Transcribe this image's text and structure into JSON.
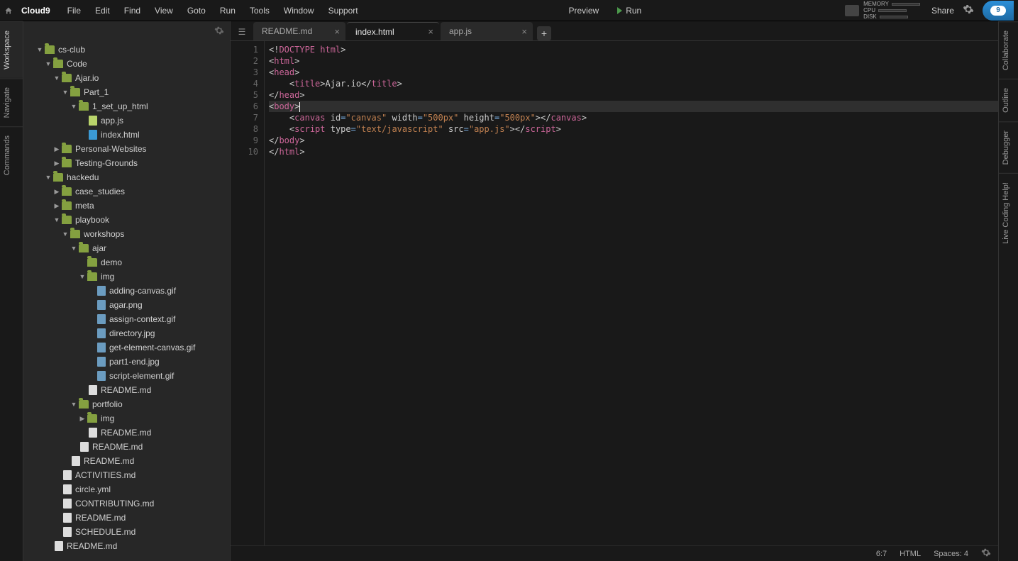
{
  "menubar": {
    "logo": "Cloud9",
    "items": [
      "File",
      "Edit",
      "Find",
      "View",
      "Goto",
      "Run",
      "Tools",
      "Window",
      "Support"
    ],
    "preview": "Preview",
    "run": "Run",
    "share": "Share",
    "stats": {
      "memory": "MEMORY",
      "cpu": "CPU",
      "disk": "DISK"
    },
    "cloud_number": "9"
  },
  "leftRail": [
    "Workspace",
    "Navigate",
    "Commands"
  ],
  "rightRail": [
    "Collaborate",
    "Outline",
    "Debugger",
    "Live Coding Help!"
  ],
  "tree": [
    {
      "depth": 0,
      "type": "folder",
      "caret": "down",
      "label": "cs-club"
    },
    {
      "depth": 1,
      "type": "folder",
      "caret": "down",
      "label": "Code"
    },
    {
      "depth": 2,
      "type": "folder",
      "caret": "down",
      "label": "Ajar.io"
    },
    {
      "depth": 3,
      "type": "folder",
      "caret": "down",
      "label": "Part_1"
    },
    {
      "depth": 4,
      "type": "folder",
      "caret": "down",
      "label": "1_set_up_html"
    },
    {
      "depth": 5,
      "type": "file",
      "icon": "js",
      "label": "app.js"
    },
    {
      "depth": 5,
      "type": "file",
      "icon": "html",
      "label": "index.html"
    },
    {
      "depth": 2,
      "type": "folder",
      "caret": "right",
      "label": "Personal-Websites"
    },
    {
      "depth": 2,
      "type": "folder",
      "caret": "right",
      "label": "Testing-Grounds"
    },
    {
      "depth": 1,
      "type": "folder",
      "caret": "down",
      "label": "hackedu"
    },
    {
      "depth": 2,
      "type": "folder",
      "caret": "right",
      "label": "case_studies"
    },
    {
      "depth": 2,
      "type": "folder",
      "caret": "right",
      "label": "meta"
    },
    {
      "depth": 2,
      "type": "folder",
      "caret": "down",
      "label": "playbook"
    },
    {
      "depth": 3,
      "type": "folder",
      "caret": "down",
      "label": "workshops"
    },
    {
      "depth": 4,
      "type": "folder",
      "caret": "down",
      "label": "ajar"
    },
    {
      "depth": 5,
      "type": "folder",
      "caret": "none",
      "label": "demo"
    },
    {
      "depth": 5,
      "type": "folder",
      "caret": "down",
      "label": "img"
    },
    {
      "depth": 6,
      "type": "file",
      "icon": "img",
      "label": "adding-canvas.gif"
    },
    {
      "depth": 6,
      "type": "file",
      "icon": "img",
      "label": "agar.png"
    },
    {
      "depth": 6,
      "type": "file",
      "icon": "img",
      "label": "assign-context.gif"
    },
    {
      "depth": 6,
      "type": "file",
      "icon": "img",
      "label": "directory.jpg"
    },
    {
      "depth": 6,
      "type": "file",
      "icon": "img",
      "label": "get-element-canvas.gif"
    },
    {
      "depth": 6,
      "type": "file",
      "icon": "img",
      "label": "part1-end.jpg"
    },
    {
      "depth": 6,
      "type": "file",
      "icon": "img",
      "label": "script-element.gif"
    },
    {
      "depth": 5,
      "type": "file",
      "icon": "file",
      "label": "README.md"
    },
    {
      "depth": 4,
      "type": "folder",
      "caret": "down",
      "label": "portfolio"
    },
    {
      "depth": 5,
      "type": "folder",
      "caret": "right",
      "label": "img"
    },
    {
      "depth": 5,
      "type": "file",
      "icon": "file",
      "label": "README.md"
    },
    {
      "depth": 4,
      "type": "file",
      "icon": "file",
      "label": "README.md"
    },
    {
      "depth": 3,
      "type": "file",
      "icon": "file",
      "label": "README.md"
    },
    {
      "depth": 2,
      "type": "file",
      "icon": "file",
      "label": "ACTIVITIES.md"
    },
    {
      "depth": 2,
      "type": "file",
      "icon": "file",
      "label": "circle.yml"
    },
    {
      "depth": 2,
      "type": "file",
      "icon": "file",
      "label": "CONTRIBUTING.md"
    },
    {
      "depth": 2,
      "type": "file",
      "icon": "file",
      "label": "README.md"
    },
    {
      "depth": 2,
      "type": "file",
      "icon": "file",
      "label": "SCHEDULE.md"
    },
    {
      "depth": 1,
      "type": "file",
      "icon": "file",
      "label": "README.md"
    }
  ],
  "tabs": [
    {
      "label": "README.md",
      "active": false
    },
    {
      "label": "index.html",
      "active": true
    },
    {
      "label": "app.js",
      "active": false
    }
  ],
  "code": {
    "lines": [
      [
        {
          "c": "t-punc",
          "t": "<!"
        },
        {
          "c": "t-doctype",
          "t": "DOCTYPE html"
        },
        {
          "c": "t-punc",
          "t": ">"
        }
      ],
      [
        {
          "c": "t-punc",
          "t": "<"
        },
        {
          "c": "t-tag",
          "t": "html"
        },
        {
          "c": "t-punc",
          "t": ">"
        }
      ],
      [
        {
          "c": "t-punc",
          "t": "<"
        },
        {
          "c": "t-tag",
          "t": "head"
        },
        {
          "c": "t-punc",
          "t": ">"
        }
      ],
      [
        {
          "c": "",
          "t": "    "
        },
        {
          "c": "t-punc",
          "t": "<"
        },
        {
          "c": "t-tag",
          "t": "title"
        },
        {
          "c": "t-punc",
          "t": ">"
        },
        {
          "c": "",
          "t": "Ajar.io"
        },
        {
          "c": "t-punc",
          "t": "</"
        },
        {
          "c": "t-tag",
          "t": "title"
        },
        {
          "c": "t-punc",
          "t": ">"
        }
      ],
      [
        {
          "c": "t-punc",
          "t": "</"
        },
        {
          "c": "t-tag",
          "t": "head"
        },
        {
          "c": "t-punc",
          "t": ">"
        }
      ],
      [
        {
          "c": "t-punc",
          "t": "<"
        },
        {
          "c": "t-tag",
          "t": "body"
        },
        {
          "c": "t-punc",
          "t": ">"
        }
      ],
      [
        {
          "c": "",
          "t": "    "
        },
        {
          "c": "t-punc",
          "t": "<"
        },
        {
          "c": "t-tag",
          "t": "canvas"
        },
        {
          "c": "",
          "t": " "
        },
        {
          "c": "t-attr",
          "t": "id"
        },
        {
          "c": "t-eq",
          "t": "="
        },
        {
          "c": "t-str",
          "t": "\"canvas\""
        },
        {
          "c": "",
          "t": " "
        },
        {
          "c": "t-attr",
          "t": "width"
        },
        {
          "c": "t-eq",
          "t": "="
        },
        {
          "c": "t-str",
          "t": "\"500px\""
        },
        {
          "c": "",
          "t": " "
        },
        {
          "c": "t-attr",
          "t": "height"
        },
        {
          "c": "t-eq",
          "t": "="
        },
        {
          "c": "t-str",
          "t": "\"500px\""
        },
        {
          "c": "t-punc",
          "t": "></"
        },
        {
          "c": "t-tag",
          "t": "canvas"
        },
        {
          "c": "t-punc",
          "t": ">"
        }
      ],
      [
        {
          "c": "",
          "t": "    "
        },
        {
          "c": "t-punc",
          "t": "<"
        },
        {
          "c": "t-tag",
          "t": "script"
        },
        {
          "c": "",
          "t": " "
        },
        {
          "c": "t-attr",
          "t": "type"
        },
        {
          "c": "t-eq",
          "t": "="
        },
        {
          "c": "t-str",
          "t": "\"text/javascript\""
        },
        {
          "c": "",
          "t": " "
        },
        {
          "c": "t-attr",
          "t": "src"
        },
        {
          "c": "t-eq",
          "t": "="
        },
        {
          "c": "t-str",
          "t": "\"app.js\""
        },
        {
          "c": "t-punc",
          "t": "></"
        },
        {
          "c": "t-tag",
          "t": "script"
        },
        {
          "c": "t-punc",
          "t": ">"
        }
      ],
      [
        {
          "c": "t-punc",
          "t": "</"
        },
        {
          "c": "t-tag",
          "t": "body"
        },
        {
          "c": "t-punc",
          "t": ">"
        }
      ],
      [
        {
          "c": "t-punc",
          "t": "</"
        },
        {
          "c": "t-tag",
          "t": "html"
        },
        {
          "c": "t-punc",
          "t": ">"
        }
      ]
    ],
    "highlight_line": 6
  },
  "statusbar": {
    "pos": "6:7",
    "lang": "HTML",
    "spaces": "Spaces: 4"
  }
}
